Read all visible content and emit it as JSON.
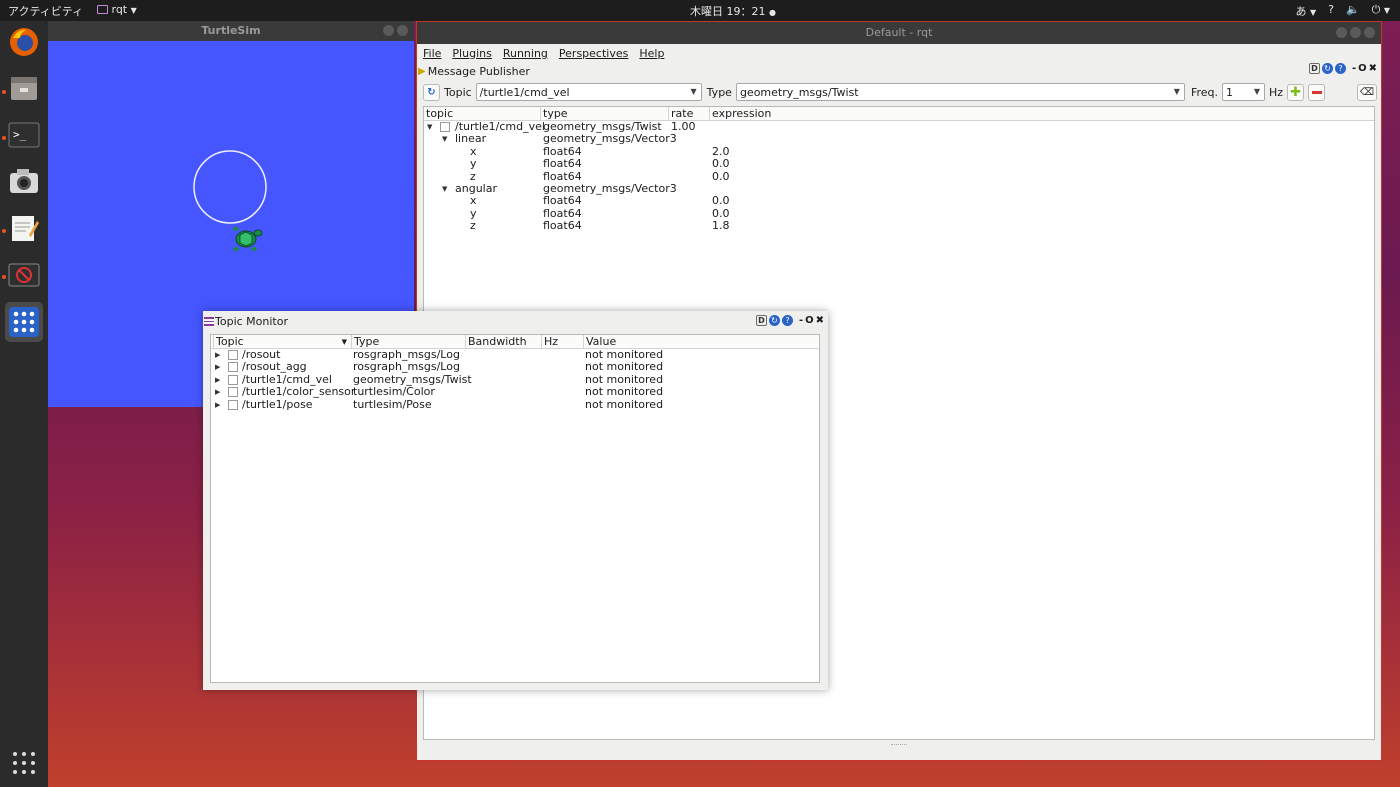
{
  "topbar": {
    "activities": "アクティビティ",
    "app_menu": "rqt",
    "clock": "木曜日 19：21",
    "input_method": "あ",
    "help": "?"
  },
  "dock": {
    "items": [
      {
        "name": "firefox-icon"
      },
      {
        "name": "files-icon"
      },
      {
        "name": "terminal-icon"
      },
      {
        "name": "camera-icon"
      },
      {
        "name": "text-editor-icon"
      },
      {
        "name": "rqt-icon"
      },
      {
        "name": "app-grid-icon"
      }
    ],
    "show_apps": "show-applications-icon"
  },
  "turtlesim": {
    "title": "TurtleSim",
    "background_color": "#4556ff"
  },
  "rqt": {
    "title": "Default - rqt",
    "menu": [
      "File",
      "Plugins",
      "Running",
      "Perspectives",
      "Help"
    ],
    "plugin_title": "Message Publisher",
    "toolbar": {
      "topic_label": "Topic",
      "topic_value": "/turtle1/cmd_vel",
      "type_label": "Type",
      "type_value": "geometry_msgs/Twist",
      "freq_label": "Freq.",
      "freq_value": "1",
      "hz_label": "Hz"
    },
    "columns": [
      "topic",
      "type",
      "rate",
      "expression"
    ],
    "rows": [
      {
        "topic": "/turtle1/cmd_vel",
        "type": "geometry_msgs/Twist",
        "rate": "1.00",
        "expression": ""
      },
      {
        "topic": "linear",
        "type": "geometry_msgs/Vector3",
        "rate": "",
        "expression": ""
      },
      {
        "topic": "x",
        "type": "float64",
        "rate": "",
        "expression": "2.0"
      },
      {
        "topic": "y",
        "type": "float64",
        "rate": "",
        "expression": "0.0"
      },
      {
        "topic": "z",
        "type": "float64",
        "rate": "",
        "expression": "0.0"
      },
      {
        "topic": "angular",
        "type": "geometry_msgs/Vector3",
        "rate": "",
        "expression": ""
      },
      {
        "topic": "x",
        "type": "float64",
        "rate": "",
        "expression": "0.0"
      },
      {
        "topic": "y",
        "type": "float64",
        "rate": "",
        "expression": "0.0"
      },
      {
        "topic": "z",
        "type": "float64",
        "rate": "",
        "expression": "1.8"
      }
    ]
  },
  "topic_monitor": {
    "title": "Topic Monitor",
    "columns": [
      "Topic",
      "Type",
      "Bandwidth",
      "Hz",
      "Value"
    ],
    "rows": [
      {
        "topic": "/rosout",
        "type": "rosgraph_msgs/Log",
        "bandwidth": "",
        "hz": "",
        "value": "not monitored"
      },
      {
        "topic": "/rosout_agg",
        "type": "rosgraph_msgs/Log",
        "bandwidth": "",
        "hz": "",
        "value": "not monitored"
      },
      {
        "topic": "/turtle1/cmd_vel",
        "type": "geometry_msgs/Twist",
        "bandwidth": "",
        "hz": "",
        "value": "not monitored"
      },
      {
        "topic": "/turtle1/color_sensor",
        "type": "turtlesim/Color",
        "bandwidth": "",
        "hz": "",
        "value": "not monitored"
      },
      {
        "topic": "/turtle1/pose",
        "type": "turtlesim/Pose",
        "bandwidth": "",
        "hz": "",
        "value": "not monitored"
      }
    ]
  },
  "dock_buttons": {
    "d": "D",
    "min": "-",
    "float": "O",
    "close": "✖"
  }
}
